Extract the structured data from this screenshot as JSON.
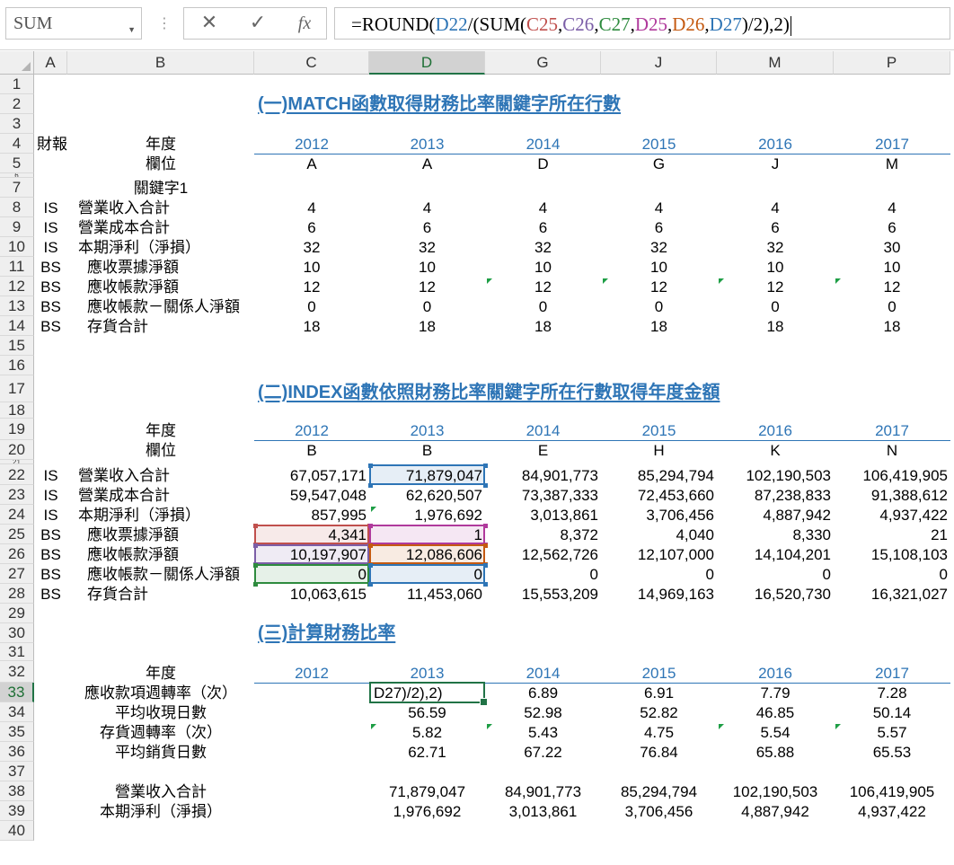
{
  "formula_bar": {
    "name_box": "SUM",
    "cancel_icon": "✕",
    "enter_icon": "✓",
    "fx_label": "fx",
    "formula_parts": [
      {
        "t": "=ROUND(",
        "c": "#000000"
      },
      {
        "t": "D22",
        "c": "#2e75b6"
      },
      {
        "t": "/(SUM(",
        "c": "#000000"
      },
      {
        "t": "C25",
        "c": "#c0504d"
      },
      {
        "t": ",",
        "c": "#000000"
      },
      {
        "t": "C26",
        "c": "#7b5ea7"
      },
      {
        "t": ",",
        "c": "#000000"
      },
      {
        "t": "C27",
        "c": "#2e8b3e"
      },
      {
        "t": ",",
        "c": "#000000"
      },
      {
        "t": "D25",
        "c": "#b03a9c"
      },
      {
        "t": ",",
        "c": "#000000"
      },
      {
        "t": "D26",
        "c": "#c55a11"
      },
      {
        "t": ",",
        "c": "#000000"
      },
      {
        "t": "D27",
        "c": "#2e75b6"
      },
      {
        "t": ")/2),2)",
        "c": "#000000"
      }
    ]
  },
  "columns": [
    "A",
    "B",
    "C",
    "D",
    "G",
    "J",
    "M",
    "P"
  ],
  "rows": [
    "1",
    "2",
    "3",
    "4",
    "5",
    "6",
    "7",
    "8",
    "9",
    "10",
    "11",
    "12",
    "13",
    "14",
    "15",
    "16",
    "17",
    "18",
    "19",
    "20",
    "21",
    "22",
    "23",
    "24",
    "25",
    "26",
    "27",
    "28",
    "29",
    "30",
    "31",
    "32",
    "33",
    "34",
    "35",
    "36",
    "37",
    "38",
    "39",
    "40"
  ],
  "cells": {
    "title1": "(一)MATCH函數取得財務比率關鍵字所在行數",
    "title2": "(二)INDEX函數依照財務比率關鍵字所在行數取得年度金額",
    "title3": "(三)計算財務比率",
    "a4": "財報",
    "lbl_year": "年度",
    "lbl_field": "欄位",
    "lbl_keyword": "關鍵字1",
    "years": [
      "2012",
      "2013",
      "2014",
      "2015",
      "2016",
      "2017"
    ],
    "fields1": [
      "A",
      "A",
      "D",
      "G",
      "J",
      "M"
    ],
    "fields2": [
      "B",
      "B",
      "E",
      "H",
      "K",
      "N"
    ],
    "statements": [
      "IS",
      "IS",
      "IS",
      "BS",
      "BS",
      "BS",
      "BS"
    ],
    "item_labels": [
      "營業收入合計",
      "營業成本合計",
      "本期淨利（淨損）",
      "應收票據淨額",
      "應收帳款淨額",
      "應收帳款－關係人淨額",
      "存貨合計"
    ],
    "section1_values": [
      [
        "4",
        "4",
        "4",
        "4",
        "4",
        "4"
      ],
      [
        "6",
        "6",
        "6",
        "6",
        "6",
        "6"
      ],
      [
        "32",
        "32",
        "32",
        "32",
        "32",
        "30"
      ],
      [
        "10",
        "10",
        "10",
        "10",
        "10",
        "10"
      ],
      [
        "12",
        "12",
        "12",
        "12",
        "12",
        "12"
      ],
      [
        "0",
        "0",
        "0",
        "0",
        "0",
        "0"
      ],
      [
        "18",
        "18",
        "18",
        "18",
        "18",
        "18"
      ]
    ],
    "section2_values": [
      [
        "67,057,171",
        "71,879,047",
        "84,901,773",
        "85,294,794",
        "102,190,503",
        "106,419,905"
      ],
      [
        "59,547,048",
        "62,620,507",
        "73,387,333",
        "72,453,660",
        "87,238,833",
        "91,388,612"
      ],
      [
        "857,995",
        "1,976,692",
        "3,013,861",
        "3,706,456",
        "4,887,942",
        "4,937,422"
      ],
      [
        "4,341",
        "1",
        "8,372",
        "4,040",
        "8,330",
        "21"
      ],
      [
        "10,197,907",
        "12,086,606",
        "12,562,726",
        "12,107,000",
        "14,104,201",
        "15,108,103"
      ],
      [
        "0",
        "0",
        "0",
        "0",
        "0",
        "0"
      ],
      [
        "10,063,615",
        "11,453,060",
        "15,553,209",
        "14,969,163",
        "16,520,730",
        "16,321,027"
      ]
    ],
    "ratio_labels": [
      "應收款項週轉率（次）",
      "平均收現日數",
      "存貨週轉率（次）",
      "平均銷貨日數"
    ],
    "ratio_values": [
      [
        "",
        "D27)/2),2)",
        "6.89",
        "6.91",
        "7.79",
        "7.28"
      ],
      [
        "",
        "56.59",
        "52.98",
        "52.82",
        "46.85",
        "50.14"
      ],
      [
        "",
        "5.82",
        "5.43",
        "4.75",
        "5.54",
        "5.57"
      ],
      [
        "",
        "62.71",
        "67.22",
        "76.84",
        "65.88",
        "65.53"
      ]
    ],
    "summary_labels": [
      "營業收入合計",
      "本期淨利（淨損）"
    ],
    "summary_values": [
      [
        "",
        "71,879,047",
        "84,901,773",
        "85,294,794",
        "102,190,503",
        "106,419,905"
      ],
      [
        "",
        "1,976,692",
        "3,013,861",
        "3,706,456",
        "4,887,942",
        "4,937,422"
      ]
    ]
  },
  "colors": {
    "accent_blue": "#2e75b6",
    "excel_green": "#217346"
  }
}
